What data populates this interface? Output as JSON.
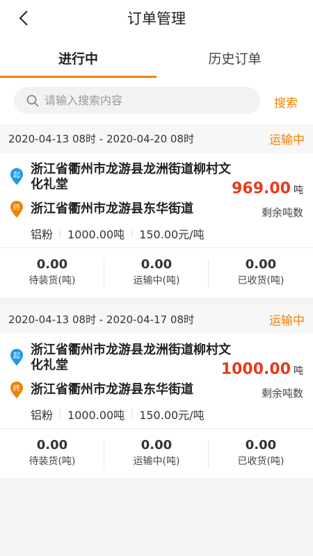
{
  "header": {
    "title": "订单管理",
    "back_icon": "chevron-left-icon"
  },
  "tabs": [
    {
      "label": "进行中",
      "active": true
    },
    {
      "label": "历史订单",
      "active": false
    }
  ],
  "search": {
    "placeholder": "请输入搜索内容",
    "button_label": "搜索"
  },
  "colors": {
    "accent": "#f08200",
    "amount": "#e73b1c",
    "start_pin": "#1e9be8",
    "end_pin": "#f08200"
  },
  "orders": [
    {
      "date_range": "2020-04-13 08时 - 2020-04-20 08时",
      "status": "运输中",
      "start_badge": "起",
      "end_badge": "终",
      "start_address": "浙江省衢州市龙游县龙洲街道柳村文化礼堂",
      "end_address": "浙江省衢州市龙游县东华街道",
      "amount": "969.00",
      "amount_unit": "吨",
      "amount_label": "剩余吨数",
      "material": "铝粉",
      "weight": "1000.00吨",
      "price": "150.00元/吨",
      "stats": [
        {
          "value": "0.00",
          "label": "待装货(吨)"
        },
        {
          "value": "0.00",
          "label": "运输中(吨)"
        },
        {
          "value": "0.00",
          "label": "已收货(吨)"
        }
      ]
    },
    {
      "date_range": "2020-04-13 08时 - 2020-04-17 08时",
      "status": "运输中",
      "start_badge": "起",
      "end_badge": "终",
      "start_address": "浙江省衢州市龙游县龙洲街道柳村文化礼堂",
      "end_address": "浙江省衢州市龙游县东华街道",
      "amount": "1000.00",
      "amount_unit": "吨",
      "amount_label": "剩余吨数",
      "material": "铝粉",
      "weight": "1000.00吨",
      "price": "150.00元/吨",
      "stats": [
        {
          "value": "0.00",
          "label": "待装货(吨)"
        },
        {
          "value": "0.00",
          "label": "运输中(吨)"
        },
        {
          "value": "0.00",
          "label": "已收货(吨)"
        }
      ]
    }
  ]
}
